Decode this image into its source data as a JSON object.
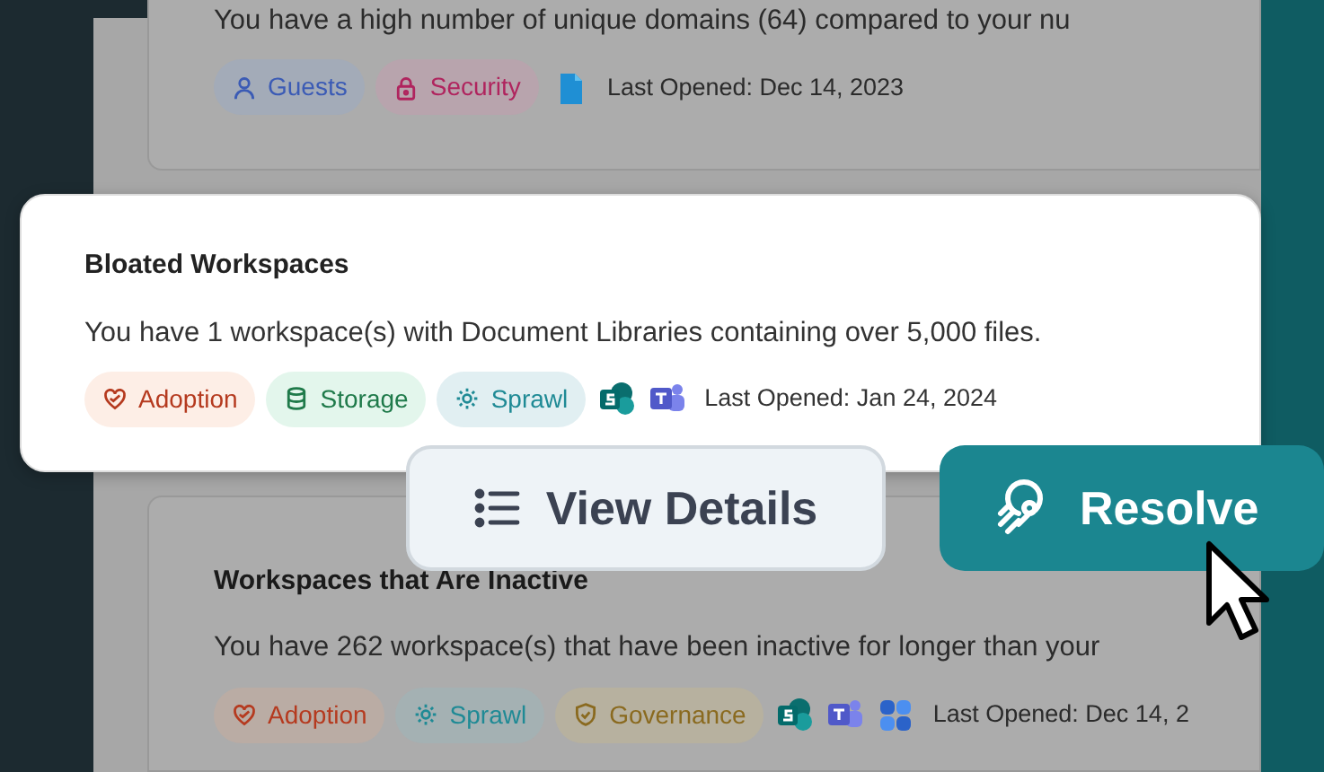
{
  "cards": [
    {
      "highlighted": false,
      "description": "You have a high number of unique domains (64) compared to your nu",
      "tags": [
        {
          "kind": "guests",
          "label": "Guests",
          "color": "#3b5bb5"
        },
        {
          "kind": "security",
          "label": "Security",
          "color": "#b0245e"
        }
      ],
      "apps": [
        {
          "kind": "file"
        }
      ],
      "last_opened": "Last Opened: Dec 14, 2023"
    },
    {
      "highlighted": true,
      "title": "Bloated Workspaces",
      "description": "You have 1 workspace(s) with Document Libraries containing over 5,000 files.",
      "tags": [
        {
          "kind": "adoption",
          "label": "Adoption",
          "color": "#b53a1f"
        },
        {
          "kind": "storage",
          "label": "Storage",
          "color": "#1f7a4a"
        },
        {
          "kind": "sprawl",
          "label": "Sprawl",
          "color": "#1f8a95"
        }
      ],
      "apps": [
        {
          "kind": "s-tile"
        },
        {
          "kind": "t-tile"
        }
      ],
      "last_opened": "Last Opened: Jan 24, 2024"
    },
    {
      "highlighted": false,
      "title": "Workspaces that Are Inactive",
      "description": "You have 262 workspace(s) that have been inactive for longer than your",
      "tags": [
        {
          "kind": "adoption",
          "label": "Adoption",
          "color": "#b53a1f"
        },
        {
          "kind": "sprawl",
          "label": "Sprawl",
          "color": "#1f8a95"
        },
        {
          "kind": "governance",
          "label": "Governance",
          "color": "#8a6a1f"
        }
      ],
      "apps": [
        {
          "kind": "s-tile"
        },
        {
          "kind": "t-tile"
        },
        {
          "kind": "cloud-tiles"
        }
      ],
      "last_opened": "Last Opened: Dec 14, 2"
    }
  ],
  "actions": [
    {
      "kind": "secondary",
      "label": "View Details"
    },
    {
      "kind": "primary",
      "label": "Resolve"
    }
  ]
}
